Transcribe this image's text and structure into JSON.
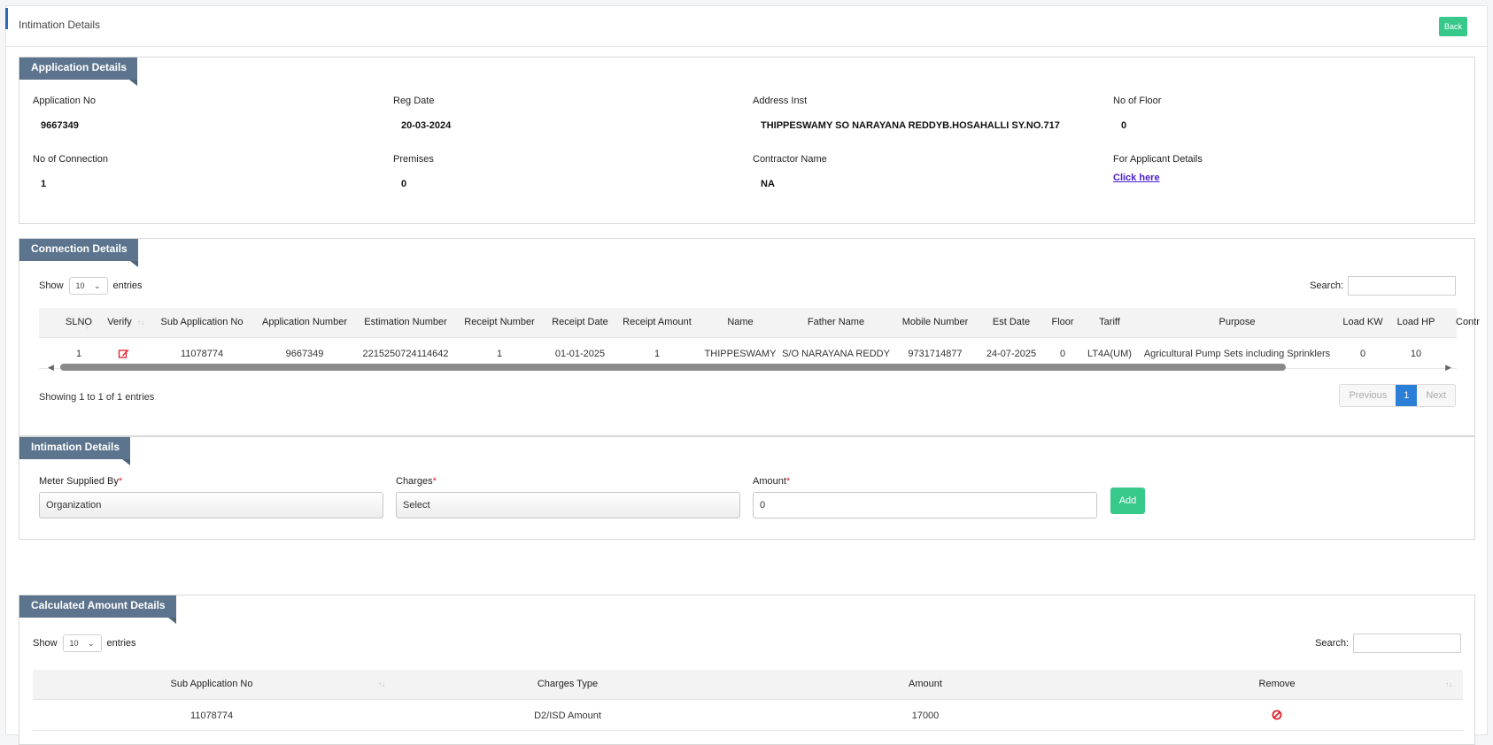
{
  "header": {
    "title": "Intimation Details",
    "back_label": "Back"
  },
  "application": {
    "section_title": "Application Details",
    "application_no": {
      "label": "Application No",
      "value": "9667349"
    },
    "reg_date": {
      "label": "Reg Date",
      "value": "20-03-2024"
    },
    "address_inst": {
      "label": "Address Inst",
      "value": "THIPPESWAMY SO NARAYANA REDDYB.HOSAHALLI SY.NO.717"
    },
    "no_of_floor": {
      "label": "No of Floor",
      "value": "0"
    },
    "no_of_connection": {
      "label": "No of Connection",
      "value": "1"
    },
    "premises": {
      "label": "Premises",
      "value": "0"
    },
    "contractor_name": {
      "label": "Contractor Name",
      "value": "NA"
    },
    "applicant_details": {
      "label": "For Applicant Details",
      "link": "Click here"
    }
  },
  "connection": {
    "section_title": "Connection Details",
    "show_label": "Show",
    "entries_label": "entries",
    "page_size": "10",
    "search_label": "Search:",
    "columns": [
      "SLNO",
      "Verify",
      "Sub Application No",
      "Application Number",
      "Estimation Number",
      "Receipt Number",
      "Receipt Date",
      "Receipt Amount",
      "Name",
      "Father Name",
      "Mobile Number",
      "Est Date",
      "Floor",
      "Tariff",
      "Purpose",
      "Load KW",
      "Load HP",
      "Contr"
    ],
    "rows": [
      [
        "1",
        "",
        "11078774",
        "9667349",
        "2215250724114642",
        "1",
        "01-01-2025",
        "1",
        "THIPPESWAMY",
        "S/O NARAYANA REDDY",
        "9731714877",
        "24-07-2025",
        "0",
        "LT4A(UM)",
        "Agricultural Pump Sets including Sprinklers",
        "0",
        "10",
        ""
      ]
    ],
    "info": "Showing 1 to 1 of 1 entries",
    "pager": {
      "previous": "Previous",
      "current": "1",
      "next": "Next"
    }
  },
  "intimation": {
    "section_title": "Intimation Details",
    "meter_label": "Meter Supplied By",
    "meter_value": "Organization",
    "charges_label": "Charges",
    "charges_value": "Select",
    "amount_label": "Amount",
    "amount_value": "0",
    "required_mark": "*",
    "add_label": "Add"
  },
  "calculated": {
    "section_title": "Calculated Amount Details",
    "show_label": "Show",
    "entries_label": "entries",
    "page_size": "10",
    "search_label": "Search:",
    "columns": [
      "Sub Application No",
      "Charges Type",
      "Amount",
      "Remove"
    ],
    "rows": [
      [
        "11078774",
        "D2/ISD Amount",
        "17000",
        ""
      ]
    ]
  },
  "icons": {
    "verify": "edit-icon",
    "remove": "remove-icon",
    "sort": "sort-icon"
  },
  "colors": {
    "accent_green": "#36c98a",
    "panel_header": "#5c748d",
    "page_blue": "#2b7fd6",
    "danger": "#e0202a"
  }
}
